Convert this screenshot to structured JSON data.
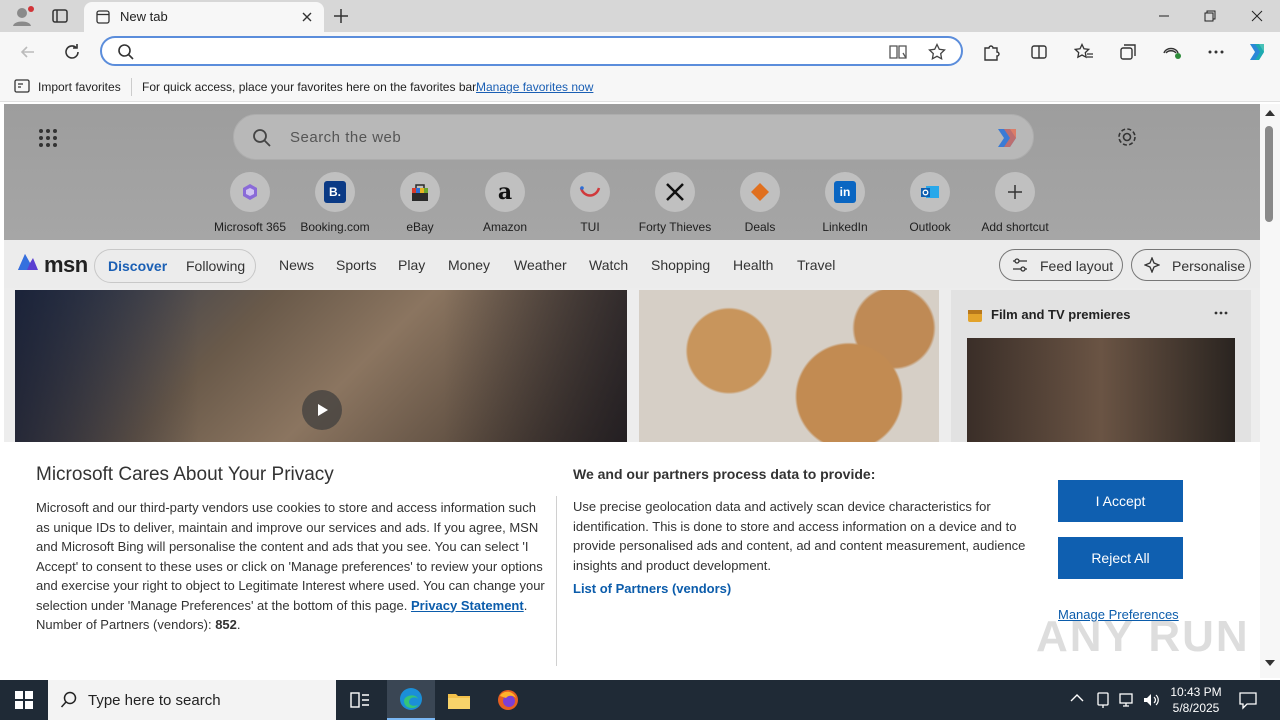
{
  "browser": {
    "tab_title": "New tab",
    "address_value": "",
    "favorites_bar": {
      "import_label": "Import favorites",
      "hint": "For quick access, place your favorites here on the favorites bar.",
      "manage_link": "Manage favorites now"
    }
  },
  "newtab": {
    "search_placeholder": "Search the web",
    "shortcuts": [
      {
        "label": "Microsoft 365",
        "icon": "microsoft365-icon"
      },
      {
        "label": "Booking.com",
        "icon": "booking-icon"
      },
      {
        "label": "eBay",
        "icon": "ebay-icon"
      },
      {
        "label": "Amazon",
        "icon": "amazon-icon"
      },
      {
        "label": "TUI",
        "icon": "tui-icon"
      },
      {
        "label": "Forty Thieves",
        "icon": "forty-thieves-icon"
      },
      {
        "label": "Deals",
        "icon": "deals-icon"
      },
      {
        "label": "LinkedIn",
        "icon": "linkedin-icon"
      },
      {
        "label": "Outlook",
        "icon": "outlook-icon"
      },
      {
        "label": "Add shortcut",
        "icon": "plus-icon"
      }
    ],
    "msn": {
      "logo": "msn",
      "tabs": [
        "Discover",
        "Following"
      ],
      "nav": [
        "News",
        "Sports",
        "Play",
        "Money",
        "Weather",
        "Watch",
        "Shopping",
        "Health",
        "Travel"
      ],
      "feed_layout": "Feed layout",
      "personalise": "Personalise"
    },
    "side_card_title": "Film and TV premieres"
  },
  "privacy": {
    "title": "Microsoft Cares About Your Privacy",
    "body": "Microsoft and our third-party vendors use cookies to store and access information such as unique IDs to deliver, maintain and improve our services and ads. If you agree, MSN and Microsoft Bing will personalise the content and ads that you see. You can select 'I Accept' to consent to these uses or click on 'Manage preferences' to review your options and exercise your right to object to Legitimate Interest where used.  You can change your selection under 'Manage Preferences' at the bottom of this page.",
    "privacy_link": "Privacy Statement",
    "partners_label": "Number of Partners (vendors):",
    "partners_count": "852",
    "right_title": "We and our partners process data to provide:",
    "right_body": "Use precise geolocation data and actively scan device characteristics for identification. This is done to store and access information on a device and to provide personalised ads and content, ad and content measurement, audience insights and product development.",
    "partners_link": "List of Partners (vendors)",
    "accept": "I Accept",
    "reject": "Reject All",
    "manage": "Manage Preferences"
  },
  "taskbar": {
    "search_placeholder": "Type here to search",
    "time": "10:43 PM",
    "date": "5/8/2025"
  },
  "watermark": "ANY RUN",
  "colors": {
    "accent": "#0f5fb0",
    "taskbar": "#1f2a36"
  }
}
